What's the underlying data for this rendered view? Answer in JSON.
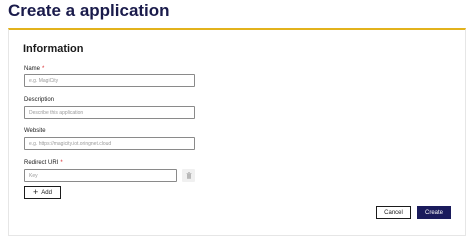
{
  "page": {
    "title": "Create a application"
  },
  "form": {
    "section_title": "Information",
    "name": {
      "label": "Name",
      "required_mark": "*",
      "placeholder": "e.g. MagiCity",
      "value": ""
    },
    "description": {
      "label": "Description",
      "placeholder": "Describe this application",
      "value": ""
    },
    "website": {
      "label": "Website",
      "placeholder": "e.g. https://magicity.iot.oringnet.cloud",
      "value": ""
    },
    "redirect_uri": {
      "label": "Redirect URI",
      "required_mark": "*",
      "placeholder": "Key",
      "value": "",
      "remove_icon": "trash-icon"
    },
    "add_label": "Add",
    "add_icon": "plus-icon"
  },
  "actions": {
    "cancel_label": "Cancel",
    "create_label": "Create"
  },
  "colors": {
    "title": "#1a1b4b",
    "accent_border": "#e2b21c",
    "primary_button": "#1a1b5c",
    "required": "#d9262b"
  }
}
